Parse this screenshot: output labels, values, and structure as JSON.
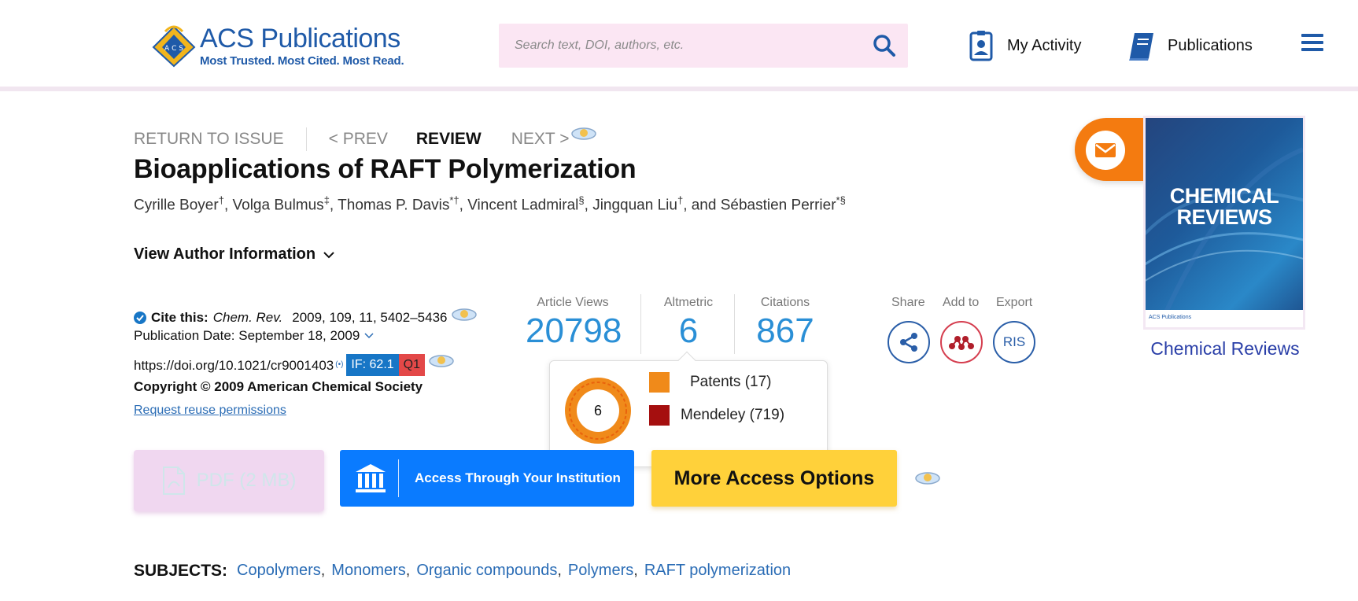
{
  "header": {
    "logo_brand_a": "ACS",
    "logo_brand_b": "Publications",
    "logo_tagline": "Most Trusted. Most Cited. Most Read.",
    "search_placeholder": "Search text, DOI, authors, etc.",
    "my_activity": "My Activity",
    "publications": "Publications"
  },
  "crumbs": {
    "return": "RETURN TO ISSUE",
    "prev": "< PREV",
    "review": "REVIEW",
    "next": "NEXT >"
  },
  "article": {
    "title": "Bioapplications of RAFT Polymerization",
    "authors": [
      {
        "name": "Cyrille Boyer",
        "mark": "†",
        "sep": ", "
      },
      {
        "name": "Volga Bulmus",
        "mark": "‡",
        "sep": ", "
      },
      {
        "name": "Thomas P. Davis",
        "mark": "*†",
        "sep": ", "
      },
      {
        "name": "Vincent Ladmiral",
        "mark": "§",
        "sep": ", "
      },
      {
        "name": "Jingquan Liu",
        "mark": "†",
        "sep": ", and "
      },
      {
        "name": "Sébastien Perrier",
        "mark": "*§",
        "sep": ""
      }
    ],
    "view_author_info": "View Author Information"
  },
  "cite": {
    "label": "Cite this:",
    "journal": "Chem. Rev.",
    "ref": "2009, 109, 11, 5402–5436",
    "pub_date": "Publication Date: September 18, 2009",
    "doi": "https://doi.org/10.1021/cr9001403",
    "if_badge": "IF: 62.1",
    "q_badge": "Q1",
    "copyright": "Copyright © 2009 American Chemical Society",
    "reuse": "Request reuse permissions"
  },
  "metrics": {
    "views_label": "Article Views",
    "views": "20798",
    "altmetric_label": "Altmetric",
    "altmetric": "6",
    "citations_label": "Citations",
    "citations": "867"
  },
  "actions": {
    "share": "Share",
    "add_to": "Add to",
    "export": "Export",
    "ris": "RIS"
  },
  "altmetric_popup": {
    "score": "6",
    "items": [
      {
        "label": "Patents (17)",
        "color": "#f08a1a"
      },
      {
        "label": "Mendeley (719)",
        "color": "#a50f0f"
      }
    ]
  },
  "buttons": {
    "pdf": "PDF (2 MB)",
    "institution": "Access Through Your Institution",
    "more": "More Access Options"
  },
  "subjects": {
    "label": "SUBJECTS:",
    "items": [
      "Copolymers",
      "Monomers",
      "Organic compounds",
      "Polymers",
      "RAFT polymerization"
    ]
  },
  "journal": {
    "cover_line1": "CHEMICAL",
    "cover_line2": "REVIEWS",
    "cover_publisher": "ACS Publications",
    "name": "Chemical Reviews"
  },
  "colors": {
    "accent_blue": "#0a7bff",
    "metric_blue": "#2a8fd6",
    "button_yellow": "#ffd13a",
    "mail_orange": "#f47b10"
  }
}
